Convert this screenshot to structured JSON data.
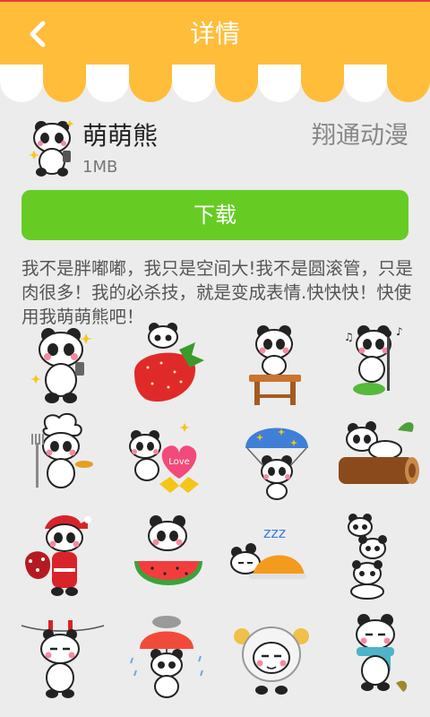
{
  "header": {
    "title": "详情",
    "back_icon": "chevron-left-icon"
  },
  "app": {
    "name": "萌萌熊",
    "size": "1MB",
    "vendor": "翔通动漫"
  },
  "download": {
    "label": "下载"
  },
  "description": "我不是胖嘟嘟，我只是空间大!我不是圆滚管，只是肉很多！我的必杀技，就是变成表情.快快快！快使用我萌萌熊吧！",
  "stickers": [
    {
      "name": "panda-selfie-sticker"
    },
    {
      "name": "panda-strawberry-sticker"
    },
    {
      "name": "panda-on-stool-sticker"
    },
    {
      "name": "panda-singing-sticker"
    },
    {
      "name": "panda-chef-sticker"
    },
    {
      "name": "panda-love-heart-sticker",
      "text": "Love"
    },
    {
      "name": "panda-parachute-sticker"
    },
    {
      "name": "panda-on-log-sticker"
    },
    {
      "name": "panda-santa-sticker"
    },
    {
      "name": "panda-watermelon-sticker"
    },
    {
      "name": "panda-sleeping-sticker",
      "text": "zzz"
    },
    {
      "name": "panda-stack-sticker"
    },
    {
      "name": "panda-clothesline-sticker"
    },
    {
      "name": "panda-umbrella-sticker"
    },
    {
      "name": "panda-sheep-costume-sticker"
    },
    {
      "name": "panda-scarf-sticker"
    }
  ],
  "colors": {
    "header": "#ffbd3a",
    "button": "#66cc24",
    "awning_stripe": "#ffbd3a"
  }
}
